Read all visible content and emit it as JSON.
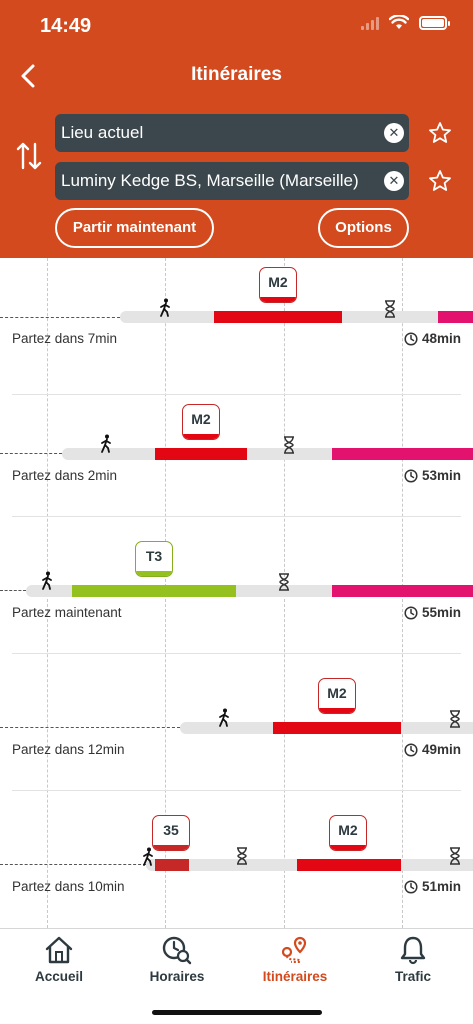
{
  "status_bar": {
    "time": "14:49"
  },
  "header": {
    "title": "Itinéraires",
    "from_value": "Lieu actuel",
    "to_value": "Luminy Kedge BS, Marseille (Marseille)",
    "leave_now_label": "Partir maintenant",
    "options_label": "Options"
  },
  "results": [
    {
      "departure": "Partez dans 7min",
      "duration": "48min",
      "lines": [
        "M2"
      ]
    },
    {
      "departure": "Partez dans 2min",
      "duration": "53min",
      "lines": [
        "M2"
      ]
    },
    {
      "departure": "Partez maintenant",
      "duration": "55min",
      "lines": [
        "T3"
      ]
    },
    {
      "departure": "Partez dans 12min",
      "duration": "49min",
      "lines": [
        "M2"
      ]
    },
    {
      "departure": "Partez dans 10min",
      "duration": "51min",
      "lines": [
        "35",
        "M2"
      ]
    }
  ],
  "tabs": [
    {
      "label": "Accueil",
      "icon": "home-icon"
    },
    {
      "label": "Horaires",
      "icon": "clock-search-icon"
    },
    {
      "label": "Itinéraires",
      "icon": "route-pin-icon"
    },
    {
      "label": "Trafic",
      "icon": "bell-icon"
    }
  ],
  "colors": {
    "header": "#D24A1D",
    "field": "#3B474C",
    "metro_m2": "#E30613",
    "tram_t3": "#95C11F",
    "bus": "#C62828",
    "connection": "#E2126E",
    "active_tab": "#D24A1D"
  }
}
